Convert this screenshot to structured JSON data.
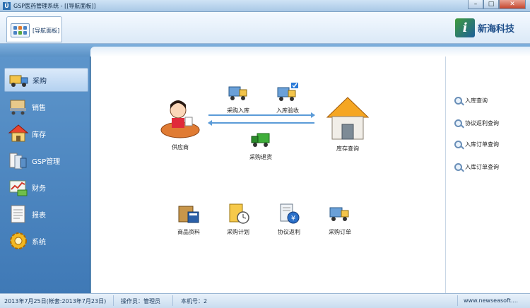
{
  "window": {
    "title": "GSP医药管理系统 - [[导航面板]]",
    "app_icon": "Ü"
  },
  "ribbon": {
    "nav_tab_label": "[导航面板]",
    "brand_name": "新海科技",
    "brand_logo": "i"
  },
  "sidebar": {
    "items": [
      {
        "label": "采购",
        "icon": "truck-icon",
        "active": true
      },
      {
        "label": "销售",
        "icon": "cart-icon"
      },
      {
        "label": "库存",
        "icon": "house-icon"
      },
      {
        "label": "GSP管理",
        "icon": "documents-icon"
      },
      {
        "label": "财务",
        "icon": "money-chart-icon"
      },
      {
        "label": "报表",
        "icon": "report-icon"
      },
      {
        "label": "系统",
        "icon": "gear-icon"
      }
    ]
  },
  "flow": {
    "supplier": "供应商",
    "purchase_in": "采购入库",
    "inbound_check": "入库验收",
    "purchase_return": "采购退货",
    "inventory_query": "库存查询"
  },
  "tools": {
    "product_info": "商品资料",
    "purchase_plan": "采购计划",
    "agreement_rebate": "协议返利",
    "purchase_order": "采购订单"
  },
  "queries": [
    "入库查询",
    "协议返利查询",
    "入库订单查询",
    "入库订单查询"
  ],
  "status": {
    "date": "2013年7月25日(帐套:2013年7月23日)",
    "operator": "操作员：管理员",
    "machine": "本机号：2",
    "website": "www.newseasoft...."
  },
  "colors": {
    "accent": "#3f79b6",
    "arrow": "#5b9bd8"
  }
}
